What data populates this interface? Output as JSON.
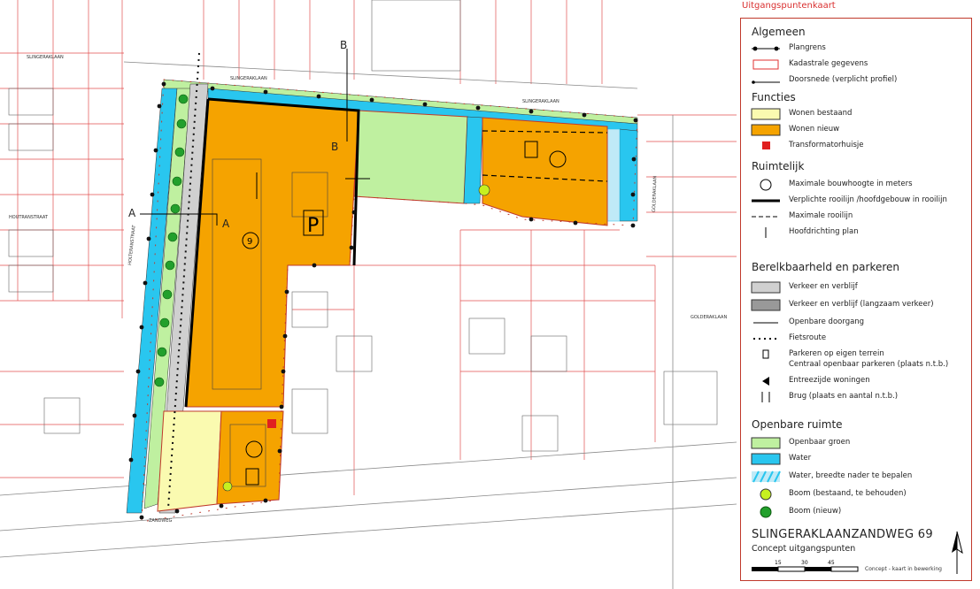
{
  "header_title": "Uitgangspuntenkaart",
  "map": {
    "street_labels": [
      "SLINGERAKLAAN",
      "SLINGERAKLAAN",
      "SLINGERAKLAAN",
      "HOLTERANSTRAAT",
      "HOUTRANSTRAAT",
      "GOLDERAKLAAN",
      "GOLDERAKLAAN",
      "ZANDWEG"
    ],
    "section_labels": [
      "A",
      "A",
      "B",
      "B"
    ],
    "height_marker": "9",
    "parking_marker": "P"
  },
  "legend": {
    "sections": [
      {
        "title": "Algemeen",
        "items": [
          "Plangrens",
          "Kadastrale gegevens",
          "Doorsnede (verplicht profiel)"
        ]
      },
      {
        "title": "Functies",
        "items": [
          "Wonen bestaand",
          "Wonen nieuw",
          "Transformatorhuisje"
        ]
      },
      {
        "title": "Ruimtelijk",
        "items": [
          "Maximale bouwhoogte in meters",
          "Verplichte rooilijn /hoofdgebouw in rooilijn",
          "Maximale rooilijn",
          "Hoofdrichting plan"
        ]
      },
      {
        "title": "Berelkbaarheld en parkeren",
        "items": [
          "Verkeer en verblijf",
          "Verkeer en verblijf (langzaam verkeer)",
          "Openbare doorgang",
          "Fietsroute",
          "Parkeren op eigen terrein",
          "Centraal openbaar parkeren (plaats n.t.b.)",
          "Entreezijde woningen",
          "Brug (plaats en aantal n.t.b.)"
        ]
      },
      {
        "title": "Openbare ruimte",
        "items": [
          "Openbaar groen",
          "Water",
          "Water, breedte nader te bepalen",
          "Boom (bestaand, te behouden)",
          "Boom (nieuw)"
        ]
      }
    ],
    "plan_title": "SLINGERAKLAANZANDWEG 69",
    "plan_subtitle": "Concept uitgangspunten",
    "scale_ticks": [
      "15",
      "30",
      "45"
    ],
    "scale_note": "Concept - kaart in bewerking"
  },
  "colors": {
    "wonen_nieuw": "#f5a300",
    "wonen_bestaand": "#fafab0",
    "groen": "#bff0a0",
    "water": "#29c6ef",
    "verkeer": "#d0d0d0",
    "kadaster": "#e23030",
    "tree_new": "#22a02c",
    "tree_existing": "#c6f020"
  }
}
